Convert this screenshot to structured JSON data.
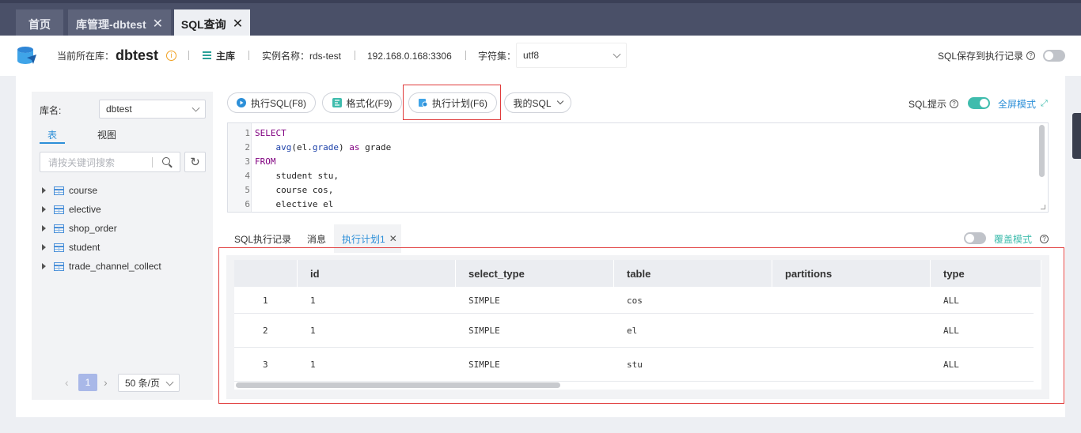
{
  "tabs": [
    {
      "label": "首页",
      "closable": false,
      "active": false
    },
    {
      "label": "库管理-dbtest",
      "closable": true,
      "active": false
    },
    {
      "label": "SQL查询",
      "closable": true,
      "active": true
    }
  ],
  "info": {
    "current_db_label": "当前所在库：",
    "current_db": "dbtest",
    "role": "主库",
    "instance_label": "实例名称：rds-test",
    "host": "192.168.0.168:3306",
    "charset_label": "字符集：",
    "charset_value": "utf8",
    "save_label": "SQL保存到执行记录"
  },
  "sidebar": {
    "db_label": "库名:",
    "db_value": "dbtest",
    "tab_table": "表",
    "tab_view": "视图",
    "search_placeholder": "请按关键词搜索",
    "tables": [
      "course",
      "elective",
      "shop_order",
      "student",
      "trade_channel_collect"
    ],
    "page": "1",
    "page_size": "50 条/页"
  },
  "toolbar": {
    "run": "执行SQL(F8)",
    "format": "格式化(F9)",
    "plan": "执行计划(F6)",
    "mysql": "我的SQL",
    "hint_label": "SQL提示",
    "fullscreen": "全屏模式"
  },
  "editor": {
    "line_numbers": [
      "1",
      "2",
      "3",
      "4",
      "5",
      "6"
    ]
  },
  "result_tabs": {
    "history": "SQL执行记录",
    "messages": "消息",
    "plan": "执行计划1",
    "overwrite": "覆盖模式"
  },
  "grid": {
    "columns": [
      "",
      "id",
      "select_type",
      "table",
      "partitions",
      "type"
    ],
    "rows": [
      [
        "1",
        "1",
        "SIMPLE",
        "cos",
        "",
        "ALL"
      ],
      [
        "2",
        "1",
        "SIMPLE",
        "el",
        "",
        "ALL"
      ],
      [
        "3",
        "1",
        "SIMPLE",
        "stu",
        "",
        "ALL"
      ]
    ]
  },
  "colors": {
    "accent": "#3fbcad",
    "link": "#2c8fd8",
    "warn": "#f0a020",
    "highlight": "#e03b3b"
  }
}
